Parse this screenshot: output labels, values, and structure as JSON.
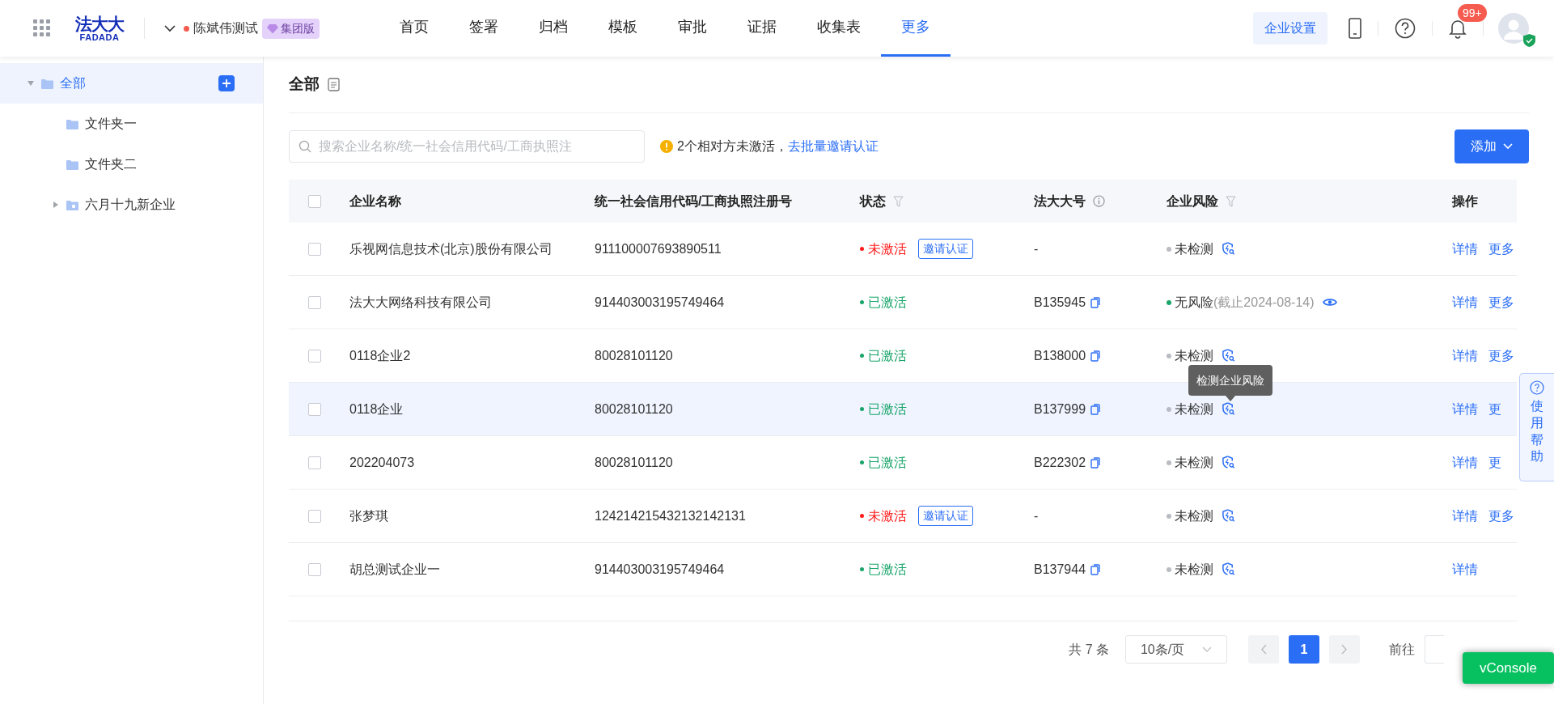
{
  "header": {
    "logo": {
      "cn": "法大大",
      "en": "FADADA"
    },
    "account": {
      "name": "陈斌伟测试",
      "badge": "集团版"
    },
    "nav": [
      {
        "label": "首页",
        "selected": false
      },
      {
        "label": "签署",
        "selected": false
      },
      {
        "label": "归档",
        "selected": false
      },
      {
        "label": "模板",
        "selected": false
      },
      {
        "label": "审批",
        "selected": false
      },
      {
        "label": "证据",
        "selected": false
      },
      {
        "label": "收集表",
        "selected": false
      },
      {
        "label": "更多",
        "selected": true
      }
    ],
    "settings_button": "企业设置",
    "notification_badge": "99+"
  },
  "sidebar": {
    "items": [
      {
        "label": "全部",
        "selected": true,
        "expanded": true,
        "children": [
          {
            "label": "文件夹一",
            "selected": false,
            "kind": "folder"
          },
          {
            "label": "文件夹二",
            "selected": false,
            "kind": "folder"
          },
          {
            "label": "六月十九新企业",
            "selected": false,
            "kind": "group"
          }
        ]
      }
    ]
  },
  "page": {
    "title": "全部",
    "search": {
      "placeholder": "搜索企业名称/统一社会信用代码/工商执照注"
    },
    "notice": {
      "text": "2个相对方未激活，",
      "link": "去批量邀请认证"
    },
    "add_button": "添加"
  },
  "table": {
    "header_checked": false,
    "columns": [
      {
        "label": "企业名称",
        "kind": "plain"
      },
      {
        "label": "统一社会信用代码/工商执照注册号",
        "kind": "plain"
      },
      {
        "label": "状态",
        "kind": "filter"
      },
      {
        "label": "法大大号",
        "kind": "info"
      },
      {
        "label": "企业风险",
        "kind": "filter"
      },
      {
        "label": "操作",
        "kind": "plain"
      }
    ],
    "rows": [
      {
        "checked": false,
        "highlighted": false,
        "name": "乐视网信息技术(北京)股份有限公司",
        "code": "911100007693890511",
        "status": {
          "label": "未激活",
          "active": false,
          "invite": "邀请认证"
        },
        "number": "-",
        "copyable": false,
        "risk": {
          "label": "未检测",
          "kind": "unchecked"
        },
        "actions": [
          "详情",
          "更多"
        ]
      },
      {
        "checked": false,
        "highlighted": false,
        "name": "法大大网络科技有限公司",
        "code": "914403003195749464",
        "status": {
          "label": "已激活",
          "active": true
        },
        "number": "B135945",
        "copyable": true,
        "risk": {
          "label": "无风险",
          "note": "(截止2024-08-14)",
          "kind": "safe"
        },
        "actions": [
          "详情",
          "更多"
        ]
      },
      {
        "checked": false,
        "highlighted": false,
        "name": "0118企业2",
        "code": "80028101120",
        "status": {
          "label": "已激活",
          "active": true
        },
        "number": "B138000",
        "copyable": true,
        "risk": {
          "label": "未检测",
          "kind": "unchecked"
        },
        "actions": [
          "详情",
          "更多"
        ]
      },
      {
        "checked": false,
        "highlighted": true,
        "name": "0118企业",
        "code": "80028101120",
        "status": {
          "label": "已激活",
          "active": true
        },
        "number": "B137999",
        "copyable": true,
        "risk": {
          "label": "未检测",
          "kind": "unchecked",
          "tooltip": "检测企业风险"
        },
        "actions": [
          "详情",
          "更"
        ]
      },
      {
        "checked": false,
        "highlighted": false,
        "name": "202204073",
        "code": "80028101120",
        "status": {
          "label": "已激活",
          "active": true
        },
        "number": "B222302",
        "copyable": true,
        "risk": {
          "label": "未检测",
          "kind": "unchecked"
        },
        "actions": [
          "详情",
          "更"
        ]
      },
      {
        "checked": false,
        "highlighted": false,
        "name": "张梦琪",
        "code": "124214215432132142131",
        "status": {
          "label": "未激活",
          "active": false,
          "invite": "邀请认证"
        },
        "number": "-",
        "copyable": false,
        "risk": {
          "label": "未检测",
          "kind": "unchecked"
        },
        "actions": [
          "详情",
          "更多"
        ]
      },
      {
        "checked": false,
        "highlighted": false,
        "name": "胡总测试企业一",
        "code": "914403003195749464",
        "status": {
          "label": "已激活",
          "active": true
        },
        "number": "B137944",
        "copyable": true,
        "risk": {
          "label": "未检测",
          "kind": "unchecked"
        },
        "actions": [
          "详情"
        ]
      }
    ]
  },
  "pagination": {
    "total": "共 7 条",
    "page_size": "10条/页",
    "pages": [
      {
        "label": "1",
        "selected": true
      }
    ],
    "goto": "前往"
  },
  "help_float": "使用帮助",
  "vconsole": "vConsole"
}
